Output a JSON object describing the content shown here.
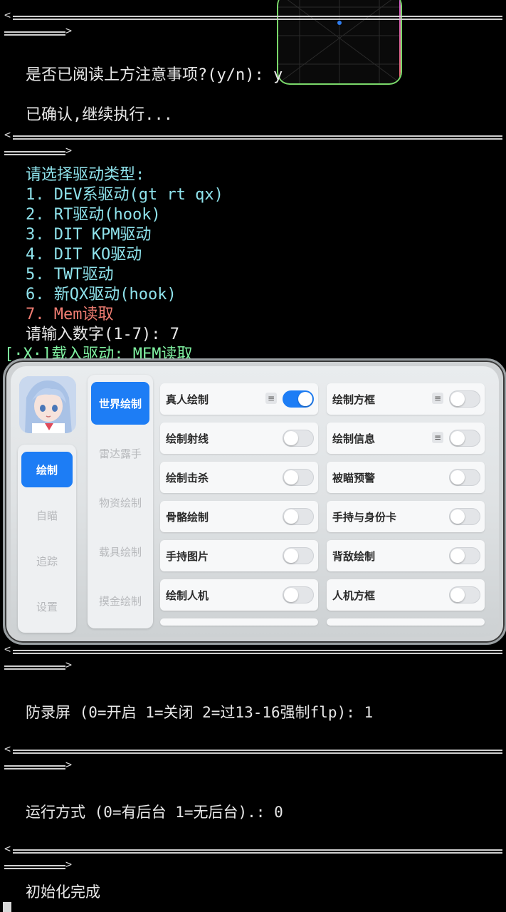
{
  "terminal": {
    "confirm_prompt": "是否已阅读上方注意事项?(y/n): y",
    "confirmed": "已确认,继续执行...",
    "driver_prompt": "请选择驱动类型:",
    "driver_options": [
      "1. DEV系驱动(gt rt qx)",
      "2. RT驱动(hook)",
      "3. DIT KPM驱动",
      "4. DIT KO驱动",
      "5. TWT驱动",
      "6. 新QX驱动(hook)"
    ],
    "driver_option_selected": "7. Mem读取",
    "input_prompt": "请输入数字(1-7): 7",
    "load_line": "[·X·]载入驱动: MEM读取",
    "screen_rec_prompt": "防录屏 (0=开启 1=关闭 2=过13-16强制flp): 1",
    "run_mode_prompt": "运行方式 (0=有后台 1=无后台).: 0",
    "init_done": "初始化完成"
  },
  "separator": {
    "left_arrow": "<",
    "right_arrow": ">"
  },
  "menu": {
    "left_tabs": [
      "绘制",
      "自瞄",
      "追踪",
      "设置"
    ],
    "active_left_tab": 0,
    "sub_tabs": [
      "世界绘制",
      "雷达露手",
      "物资绘制",
      "载具绘制",
      "摸金绘制"
    ],
    "active_sub_tab": 0,
    "features": [
      {
        "label": "真人绘制",
        "menu": true,
        "on": true
      },
      {
        "label": "绘制方框",
        "menu": true,
        "on": false
      },
      {
        "label": "绘制射线",
        "menu": false,
        "on": false
      },
      {
        "label": "绘制信息",
        "menu": true,
        "on": false
      },
      {
        "label": "绘制击杀",
        "menu": false,
        "on": false
      },
      {
        "label": "被瞄预警",
        "menu": false,
        "on": false
      },
      {
        "label": "骨骼绘制",
        "menu": false,
        "on": false
      },
      {
        "label": "手持与身份卡",
        "menu": false,
        "on": false
      },
      {
        "label": "手持图片",
        "menu": false,
        "on": false
      },
      {
        "label": "背敌绘制",
        "menu": false,
        "on": false
      },
      {
        "label": "绘制人机",
        "menu": false,
        "on": false
      },
      {
        "label": "人机方框",
        "menu": false,
        "on": false
      }
    ],
    "menu_glyph": "≡"
  },
  "colors": {
    "accent": "#1d7df5",
    "terminal_cyan": "#8fe3ec",
    "terminal_red": "#f07d72"
  }
}
